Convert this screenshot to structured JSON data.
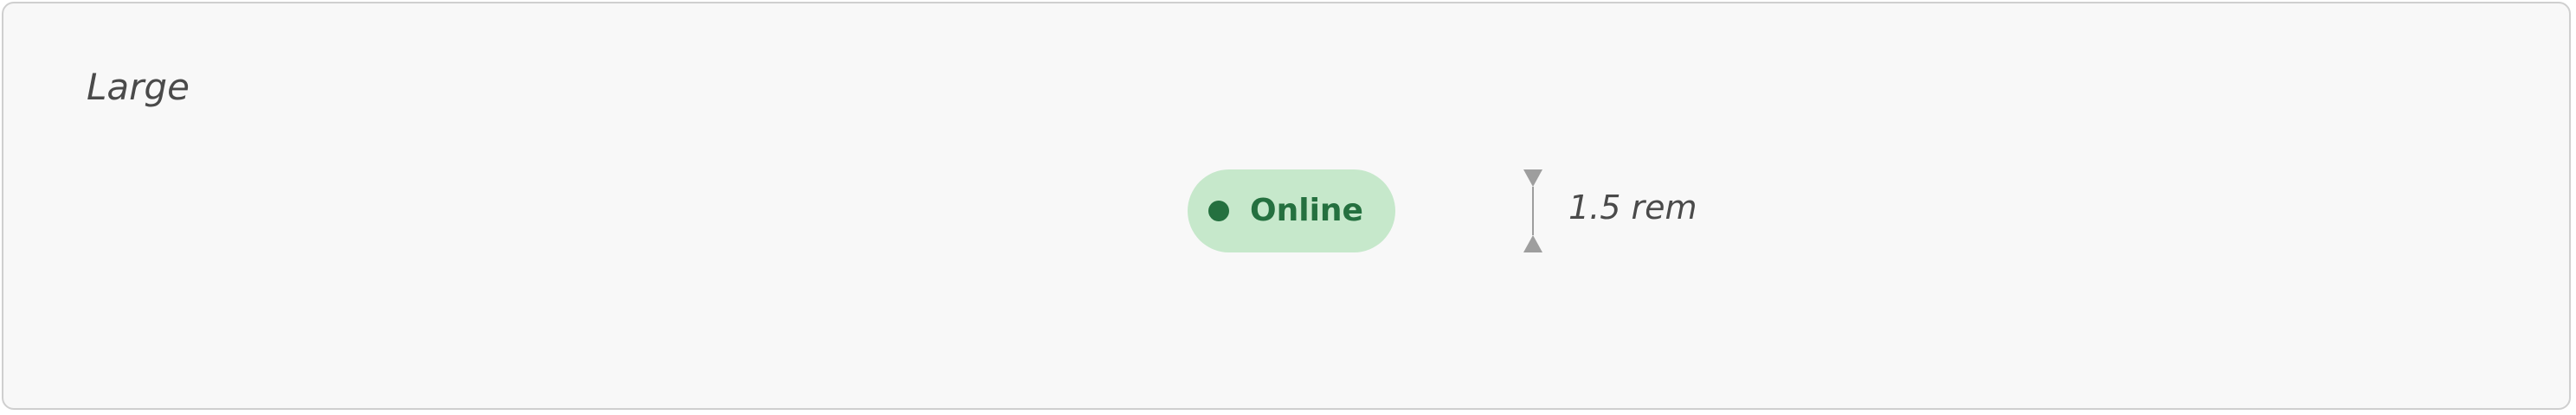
{
  "section": {
    "size_label": "Large"
  },
  "badge": {
    "label": "Online",
    "background_color": "#c6e8cb",
    "text_color": "#24703f",
    "dot_color": "#24703f"
  },
  "dimension": {
    "label": "1.5 rem",
    "indicator_color": "#9e9e9e"
  },
  "icons": {
    "status_dot": "status-dot-icon",
    "height_marker": "height-measure-icon"
  }
}
